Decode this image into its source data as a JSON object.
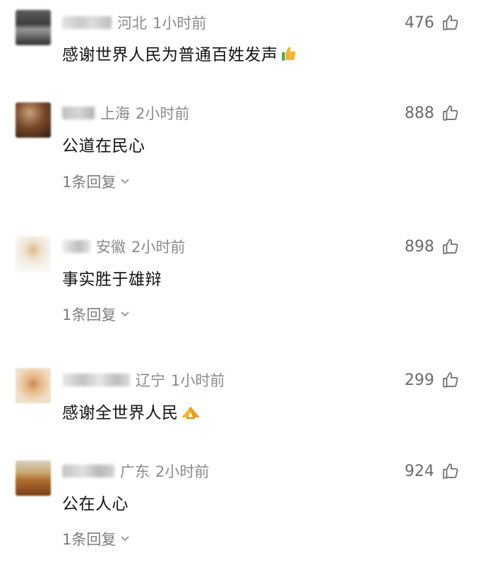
{
  "comments": [
    {
      "region": "河北",
      "time": "1小时前",
      "likes": "476",
      "text": "感谢世界人民为普通百姓发声",
      "emoji": "thumbs-up-icon"
    },
    {
      "region": "上海",
      "time": "2小时前",
      "likes": "888",
      "text": "公道在民心",
      "reply": "1条回复"
    },
    {
      "region": "安徽",
      "time": "2小时前",
      "likes": "898",
      "text": "事实胜于雄辩",
      "reply": "1条回复"
    },
    {
      "region": "辽宁",
      "time": "1小时前",
      "likes": "299",
      "text": "感谢全世界人民",
      "emoji": "praying-hands-icon"
    },
    {
      "region": "广东",
      "time": "2小时前",
      "likes": "924",
      "text": "公在人心",
      "reply": "1条回复"
    }
  ],
  "colors": {
    "meta_text": "#8a8a8a",
    "body_text": "#141414",
    "reply_text": "#7d7d7d",
    "like_icon": "#6b6b6b"
  }
}
